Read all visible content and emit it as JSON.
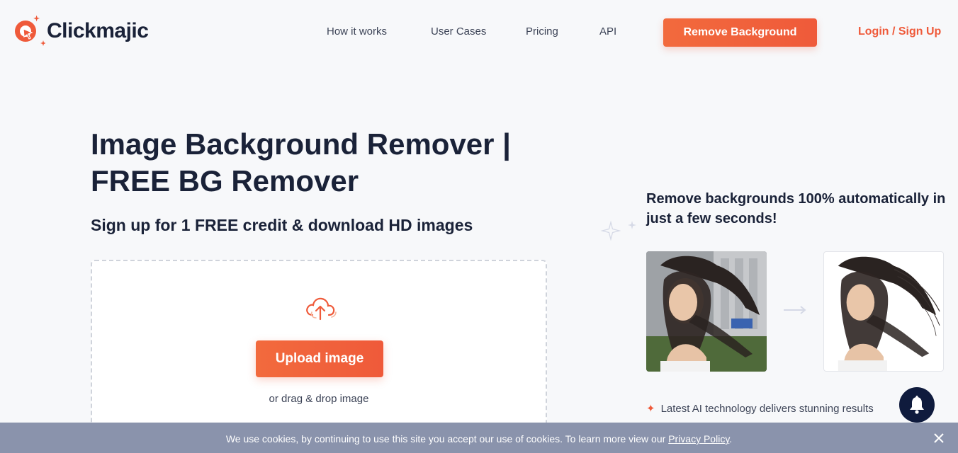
{
  "brand": {
    "name": "Clickmajic",
    "accent_color": "#ef5a3a",
    "dark_color": "#1a2238"
  },
  "nav": {
    "items": [
      {
        "label": "How it works"
      },
      {
        "label": "User Cases"
      },
      {
        "label": "Pricing"
      },
      {
        "label": "API"
      }
    ],
    "cta_label": "Remove Background",
    "login_label": "Login / Sign Up"
  },
  "hero": {
    "title": "Image Background Remover | FREE BG Remover",
    "subtitle": "Sign up for 1 FREE credit & download HD images",
    "upload_label": "Upload image",
    "drag_text": "or drag & drop image"
  },
  "showcase": {
    "title": "Remove backgrounds 100% automatically in just a few seconds!",
    "feature_1": "Latest AI technology delivers stunning results"
  },
  "cookie": {
    "text": "We use cookies, by continuing to use this site you accept our use of cookies. To learn more view our ",
    "link_label": "Privacy Policy",
    "suffix": "."
  },
  "icons": {
    "upload": "cloud-upload-icon",
    "bell": "bell-icon",
    "close": "close-icon",
    "arrow": "arrow-right-icon"
  }
}
